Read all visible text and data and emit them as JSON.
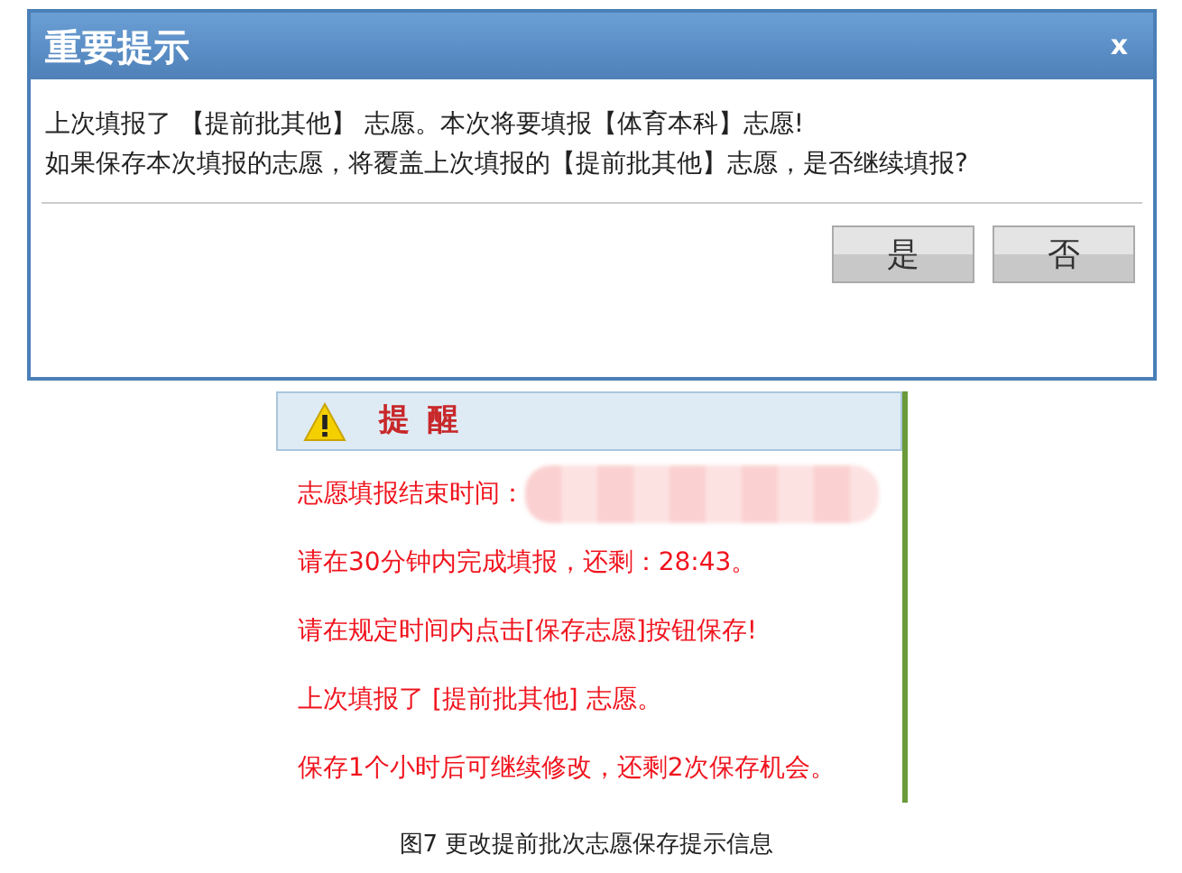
{
  "dialog": {
    "title": "重要提示",
    "close": "x",
    "message_lines": [
      "上次填报了 【提前批其他】 志愿。本次将要填报【体育本科】志愿!",
      "如果保存本次填报的志愿，将覆盖上次填报的【提前批其他】志愿，是否继续填报?"
    ],
    "buttons": [
      "是",
      "否"
    ]
  },
  "reminder": {
    "title": "提 醒",
    "lines": [
      {
        "kind": "masked",
        "text": "志愿填报结束时间："
      },
      {
        "kind": "plain",
        "text": "请在30分钟内完成填报，还剩：28:43。"
      },
      {
        "kind": "plain",
        "text": "请在规定时间内点击[保存志愿]按钮保存!"
      },
      {
        "kind": "plain",
        "text": "上次填报了 [提前批其他] 志愿。"
      },
      {
        "kind": "plain",
        "text": "保存1个小时后可继续修改，还剩2次保存机会。"
      }
    ]
  },
  "caption": "图7 更改提前批次志愿保存提示信息"
}
